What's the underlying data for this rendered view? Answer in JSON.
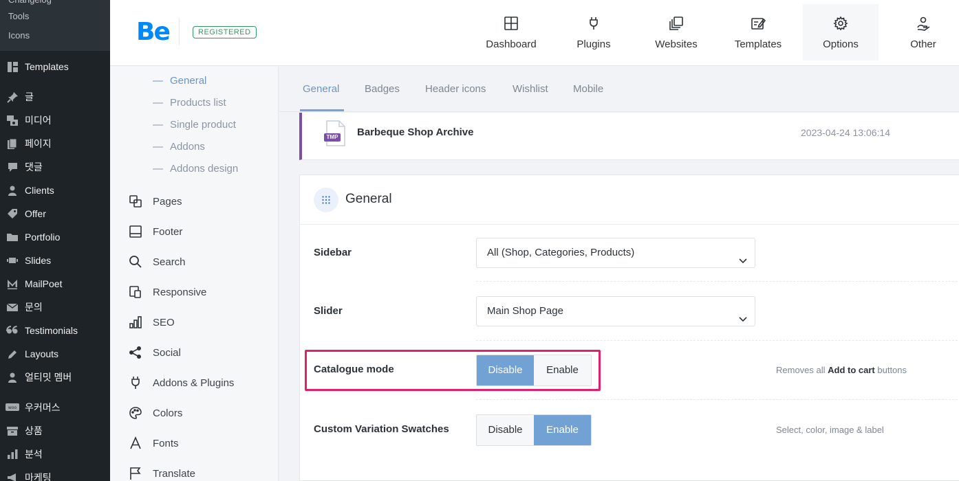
{
  "wp_sidebar": {
    "submenu": [
      "Changelog",
      "Tools",
      "Icons"
    ],
    "items": [
      {
        "label": "Templates",
        "icon": "templates-icon"
      },
      {
        "label": "글",
        "icon": "pin-icon"
      },
      {
        "label": "미디어",
        "icon": "media-icon"
      },
      {
        "label": "페이지",
        "icon": "page-icon"
      },
      {
        "label": "댓글",
        "icon": "comment-icon"
      },
      {
        "label": "Clients",
        "icon": "user-icon"
      },
      {
        "label": "Offer",
        "icon": "tag-icon"
      },
      {
        "label": "Portfolio",
        "icon": "folder-icon"
      },
      {
        "label": "Slides",
        "icon": "slides-icon"
      },
      {
        "label": "MailPoet",
        "icon": "mailpoet-icon"
      },
      {
        "label": "문의",
        "icon": "mail-icon"
      },
      {
        "label": "Testimonials",
        "icon": "quote-icon"
      },
      {
        "label": "Layouts",
        "icon": "pencil-icon"
      },
      {
        "label": "얼티밋 멤버",
        "icon": "member-icon"
      },
      {
        "label": "우커머스",
        "icon": "woo-icon"
      },
      {
        "label": "상품",
        "icon": "box-icon"
      },
      {
        "label": "분석",
        "icon": "chart-icon"
      },
      {
        "label": "마케팅",
        "icon": "megaphone-icon"
      }
    ]
  },
  "header": {
    "logo": "Be",
    "badge": "REGISTERED",
    "nav": [
      {
        "label": "Dashboard",
        "icon": "dashboard-icon"
      },
      {
        "label": "Plugins",
        "icon": "plug-icon"
      },
      {
        "label": "Websites",
        "icon": "websites-icon"
      },
      {
        "label": "Templates",
        "icon": "templates-edit-icon"
      },
      {
        "label": "Options",
        "icon": "gear-icon"
      },
      {
        "label": "Other",
        "icon": "other-icon"
      }
    ]
  },
  "options_nav": {
    "sub_items": [
      "General",
      "Products list",
      "Single product",
      "Addons",
      "Addons design"
    ],
    "sections": [
      {
        "label": "Pages",
        "icon": "pages-icon"
      },
      {
        "label": "Footer",
        "icon": "footer-icon"
      },
      {
        "label": "Search",
        "icon": "search-icon"
      },
      {
        "label": "Responsive",
        "icon": "responsive-icon"
      },
      {
        "label": "SEO",
        "icon": "seo-icon"
      },
      {
        "label": "Social",
        "icon": "share-icon"
      },
      {
        "label": "Addons & Plugins",
        "icon": "plug-icon"
      },
      {
        "label": "Colors",
        "icon": "palette-icon"
      },
      {
        "label": "Fonts",
        "icon": "font-icon"
      },
      {
        "label": "Translate",
        "icon": "flag-icon"
      }
    ]
  },
  "tabs": [
    "General",
    "Badges",
    "Header icons",
    "Wishlist",
    "Mobile"
  ],
  "template_card": {
    "icon_text": "TMP",
    "name": "Barbeque Shop Archive",
    "date": "2023-04-24 13:06:14"
  },
  "panel": {
    "title": "General",
    "sidebar_label": "Sidebar",
    "sidebar_value": "All (Shop, Categories, Products)",
    "slider_label": "Slider",
    "slider_value": "Main Shop Page",
    "catalogue_label": "Catalogue mode",
    "catalogue_options": [
      "Disable",
      "Enable"
    ],
    "catalogue_hint_pre": "Removes all ",
    "catalogue_hint_bold": "Add to cart",
    "catalogue_hint_post": " buttons",
    "swatches_label": "Custom Variation Swatches",
    "swatches_options": [
      "Disable",
      "Enable"
    ],
    "swatches_hint": "Select, color, image & label"
  },
  "colors": {
    "accent": "#72a1d4",
    "highlight": "#e0206a",
    "template_border": "#7b4ea8"
  }
}
